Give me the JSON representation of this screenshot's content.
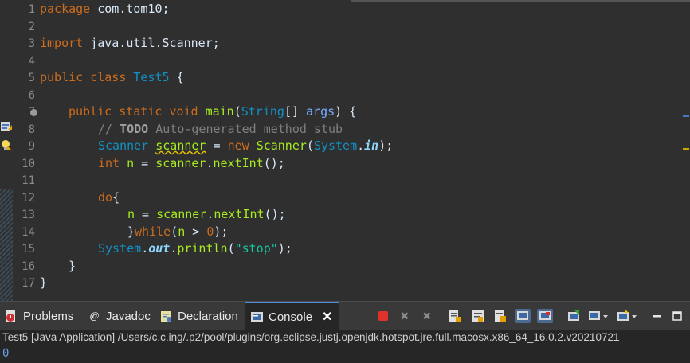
{
  "editor": {
    "line_numbers": [
      "1",
      "2",
      "3",
      "4",
      "5",
      "6",
      "7",
      "8",
      "9",
      "10",
      "11",
      "12",
      "13",
      "14",
      "15",
      "16",
      "17"
    ],
    "code": {
      "l1_kw": "package",
      "l1_rest": " com.tom10;",
      "l3_kw": "import",
      "l3_rest": " java.util.Scanner;",
      "l5_kw1": "public",
      "l5_kw2": "class",
      "l5_name": "Test5",
      "l5_rest": " {",
      "l7_kw1": "public",
      "l7_kw2": "static",
      "l7_kw3": "void",
      "l7_fn": "main",
      "l7_p1": "(",
      "l7_ty": "String",
      "l7_p2": "[] ",
      "l7_arg": "args",
      "l7_p3": ") {",
      "l8_c1": "// ",
      "l8_todo": "TODO",
      "l8_c2": " Auto-generated method stub",
      "l9_ty": "Scanner",
      "l9_var": "scanner",
      "l9_eq": " = ",
      "l9_new": "new",
      "l9_fn": "Scanner",
      "l9_p1": "(",
      "l9_cls": "System",
      "l9_dot": ".",
      "l9_fld": "in",
      "l9_p2": ");",
      "l10_kw": "int",
      "l10_var": "n",
      "l10_eq": " = ",
      "l10_obj": "scanner",
      "l10_dot": ".",
      "l10_fn": "nextInt",
      "l10_p": "();",
      "l12_kw": "do",
      "l12_p": "{",
      "l13_var": "n",
      "l13_eq": " = ",
      "l13_obj": "scanner",
      "l13_dot": ".",
      "l13_fn": "nextInt",
      "l13_p": "();",
      "l14_p1": "}",
      "l14_kw": "while",
      "l14_p2": "(",
      "l14_var": "n",
      "l14_op": " > ",
      "l14_num": "0",
      "l14_p3": ");",
      "l15_cls": "System",
      "l15_dot": ".",
      "l15_fld": "out",
      "l15_dot2": ".",
      "l15_fn": "println",
      "l15_p1": "(",
      "l15_str": "\"stop\"",
      "l15_p2": ");",
      "l16": "}",
      "l17": "}"
    }
  },
  "views": {
    "tabs": [
      {
        "label": "Problems",
        "icon": "problems-icon"
      },
      {
        "label": "Javadoc",
        "icon": "javadoc-icon"
      },
      {
        "label": "Declaration",
        "icon": "declaration-icon"
      },
      {
        "label": "Console",
        "icon": "console-icon",
        "active": true
      }
    ],
    "toolbar_icons": [
      "terminate-icon",
      "remove-launch-icon",
      "remove-all-launches-icon",
      "scroll-lock-icon",
      "word-wrap-icon",
      "show-console-on-output-icon",
      "show-console-on-error-icon",
      "pin-console-icon",
      "display-selected-console-icon",
      "open-console-icon",
      "minimize-icon",
      "maximize-icon"
    ]
  },
  "console": {
    "path": "Test5 [Java Application] /Users/c.c.ing/.p2/pool/plugins/org.eclipse.justj.openjdk.hotspot.jre.full.macosx.x86_64_16.0.2.v20210721",
    "output": "0"
  },
  "colors": {
    "keyword": "#cc6c1d",
    "type": "#1290c3",
    "method": "#a7ec21",
    "field": "#8dd7fc",
    "string": "#17c6a3",
    "active_tab_accent": "#4e8fd8",
    "terminate": "#e0322a"
  }
}
